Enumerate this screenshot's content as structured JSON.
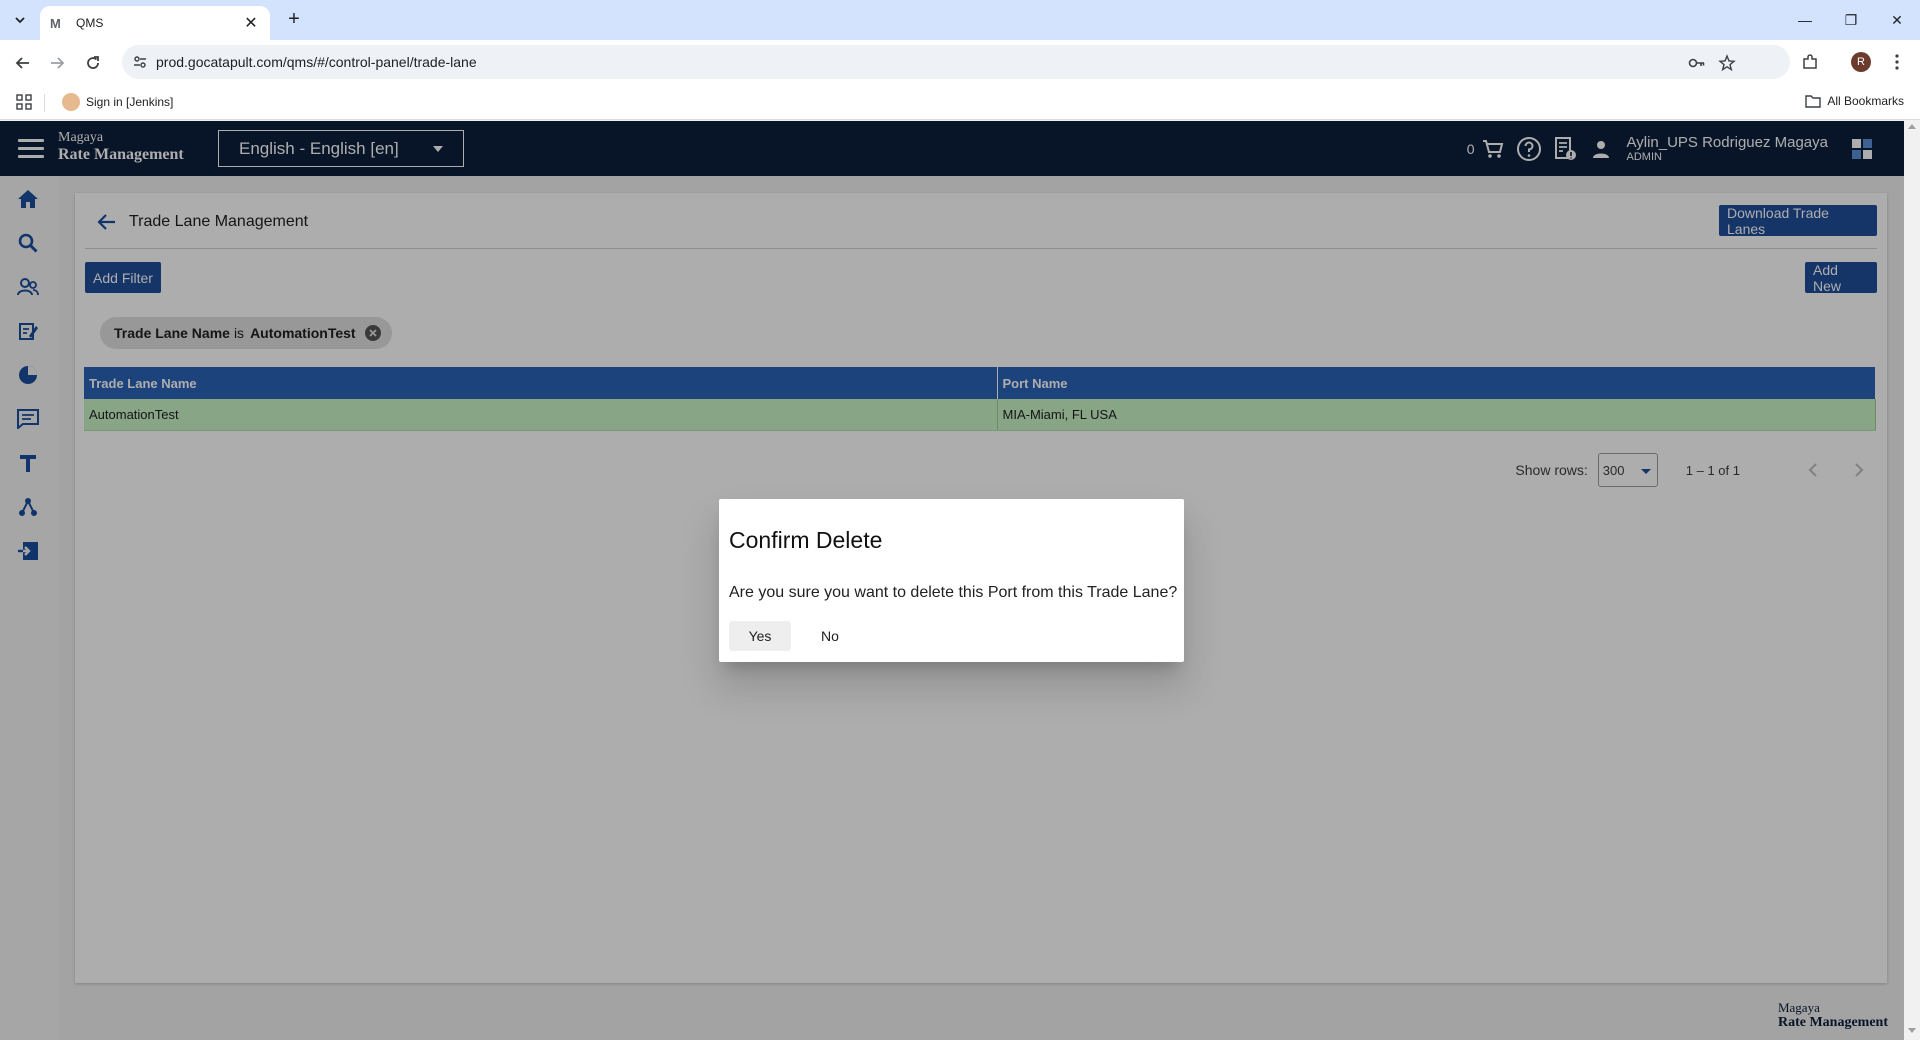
{
  "browser": {
    "tab_title": "QMS",
    "tab_favicon": "M",
    "url": "prod.gocatapult.com/qms/#/control-panel/trade-lane",
    "bookmark_item": "Sign in [Jenkins]",
    "all_bookmarks": "All Bookmarks",
    "profile_initial": "R"
  },
  "header": {
    "brand_top": "Magaya",
    "brand_bottom": "Rate Management",
    "language": "English - English [en]",
    "cart_count": "0",
    "user_name": "Aylin_UPS Rodriguez Magaya",
    "user_role": "ADMIN"
  },
  "sidebar": {
    "items": [
      "home-icon",
      "search-icon",
      "users-icon",
      "edit-document-icon",
      "pie-chart-icon",
      "chat-icon",
      "text-icon",
      "network-icon",
      "import-icon"
    ]
  },
  "page": {
    "title": "Trade Lane Management",
    "download_button": "Download Trade Lanes",
    "add_filter_button": "Add Filter",
    "add_new_button": "Add New",
    "filter_chip": {
      "field": "Trade Lane Name",
      "operator": "is",
      "value": "AutomationTest"
    }
  },
  "table": {
    "columns": [
      "Trade Lane Name",
      "Port Name"
    ],
    "rows": [
      [
        "AutomationTest",
        "MIA-Miami, FL USA"
      ]
    ]
  },
  "pager": {
    "rows_label": "Show rows:",
    "rows_value": "300",
    "range": "1 – 1 of 1"
  },
  "footer": {
    "brand_top": "Magaya",
    "brand_bottom": "Rate Management"
  },
  "dialog": {
    "title": "Confirm Delete",
    "message": "Are you sure you want to delete this Port from this Trade Lane?",
    "yes": "Yes",
    "no": "No"
  },
  "colors": {
    "header_bg": "#0d1f3c",
    "primary": "#1f4e9a",
    "table_header": "#2b63b7",
    "row_highlight": "#c9f3c4"
  }
}
